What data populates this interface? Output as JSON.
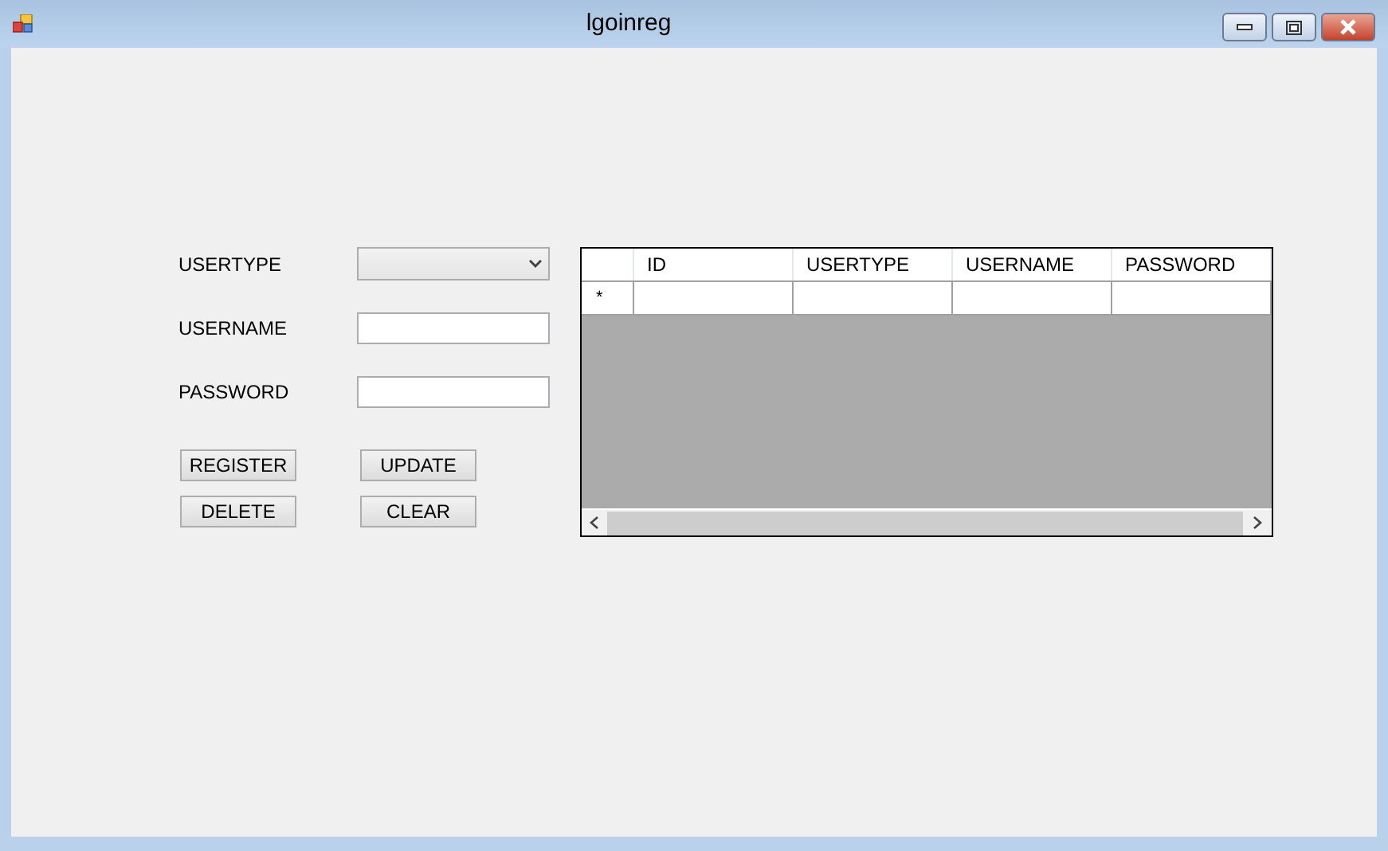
{
  "window": {
    "title": "lgoinreg"
  },
  "form": {
    "fields": [
      {
        "kind": "dropdown",
        "label": "USERTYPE"
      },
      {
        "kind": "text",
        "label": "USERNAME"
      },
      {
        "kind": "text",
        "label": "PASSWORD"
      }
    ],
    "buttons": [
      "REGISTER",
      "UPDATE",
      "DELETE",
      "CLEAR"
    ]
  },
  "table": {
    "columns": [
      "ID",
      "USERTYPE",
      "USERNAME",
      "PASSWORD"
    ],
    "new_row_marker": "*"
  }
}
